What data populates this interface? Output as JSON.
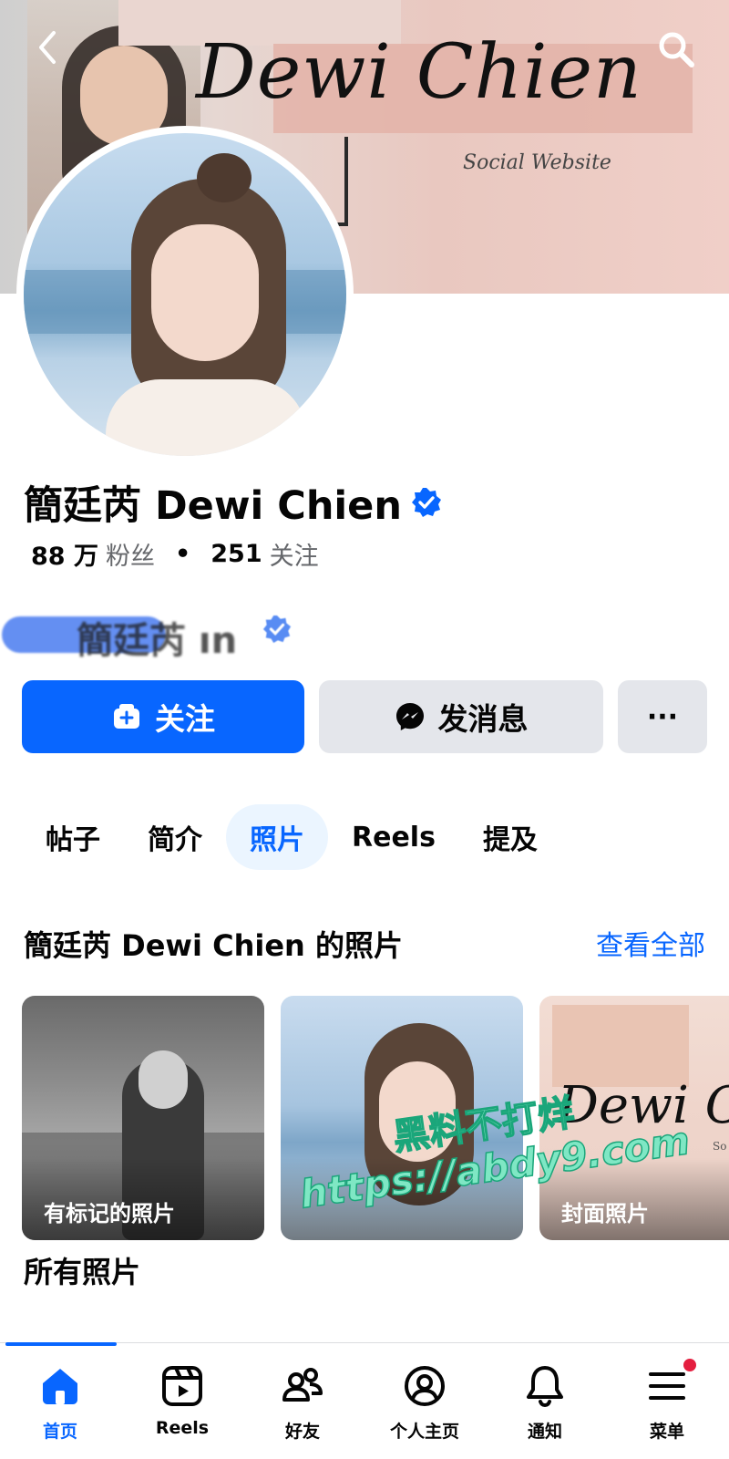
{
  "cover": {
    "title": "Dewi Chien",
    "subtitle": "Social Website"
  },
  "profile": {
    "name": "簡廷芮 Dewi Chien",
    "followers_count": "88 万",
    "followers_label": "粉丝",
    "following_count": "251",
    "following_label": "关注",
    "stats_separator": "•",
    "verified_color": "#0866ff"
  },
  "ghost_header": {
    "text": "簡廷芮 ın"
  },
  "actions": {
    "follow_label": "关注",
    "message_label": "发消息",
    "more_label": "···"
  },
  "tabs": [
    {
      "label": "帖子",
      "active": false
    },
    {
      "label": "简介",
      "active": false
    },
    {
      "label": "照片",
      "active": true
    },
    {
      "label": "Reels",
      "active": false
    },
    {
      "label": "提及",
      "active": false
    }
  ],
  "photos_section": {
    "title": "簡廷芮 Dewi Chien 的照片",
    "see_all_label": "查看全部",
    "thumbnails": [
      {
        "label": "有标记的照片"
      },
      {
        "label": ""
      },
      {
        "label": "封面照片",
        "overlay_text": "Dewi C",
        "overlay_sub": "So"
      }
    ]
  },
  "watermark": {
    "line1": "黑料不打烊",
    "line2": "https://abdy9.com"
  },
  "all_photos_title": "所有照片",
  "bottom_nav": [
    {
      "label": "首页",
      "icon": "home-icon",
      "active": true
    },
    {
      "label": "Reels",
      "icon": "reels-icon",
      "active": false
    },
    {
      "label": "好友",
      "icon": "friends-icon",
      "active": false
    },
    {
      "label": "个人主页",
      "icon": "profile-icon",
      "active": false
    },
    {
      "label": "通知",
      "icon": "bell-icon",
      "active": false
    },
    {
      "label": "菜单",
      "icon": "menu-icon",
      "active": false,
      "badge": true
    }
  ],
  "colors": {
    "accent": "#0866ff",
    "button_gray": "#e4e6eb",
    "badge_red": "#e41e3f"
  }
}
